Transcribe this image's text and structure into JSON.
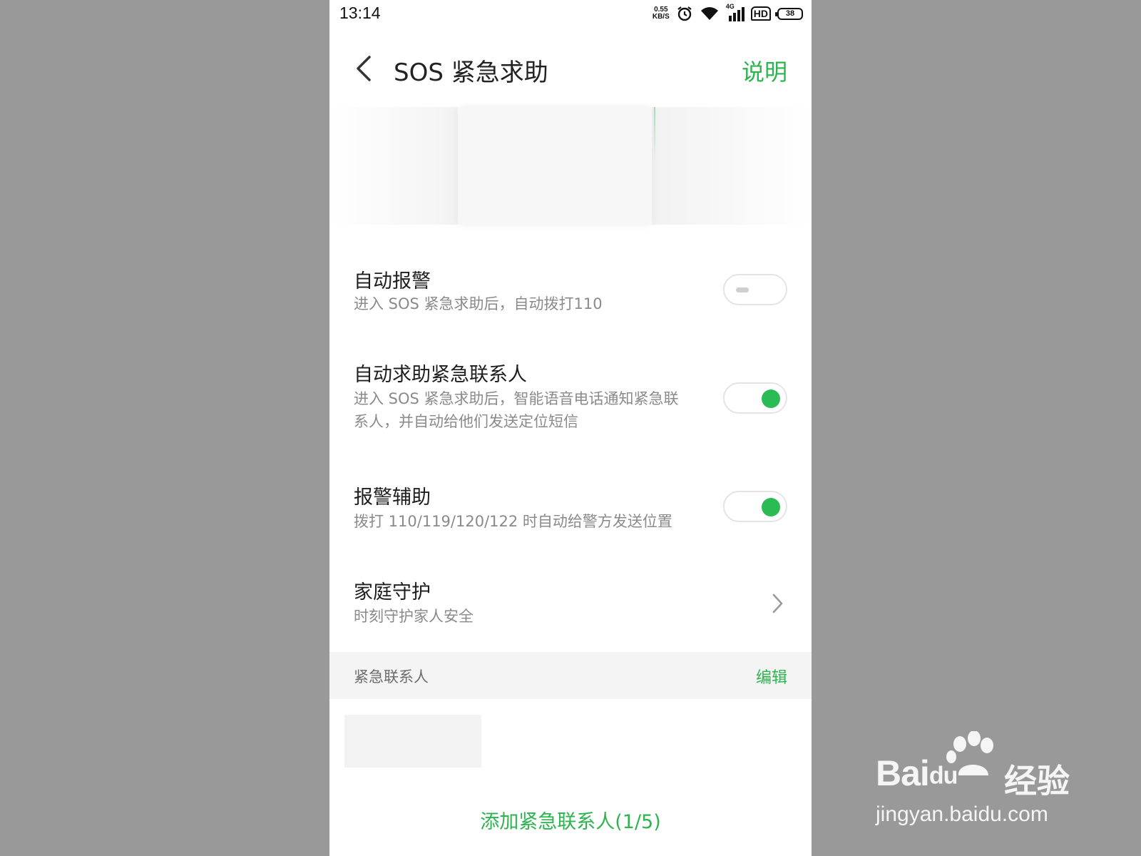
{
  "status_bar": {
    "time": "13:14",
    "net_speed_value": "0.55",
    "net_speed_unit": "KB/S",
    "network_type": "4G",
    "hd_label": "HD",
    "battery": "38",
    "icons": [
      "alarm-icon",
      "wifi-icon",
      "signal-icon",
      "hd-icon",
      "battery-icon"
    ]
  },
  "header": {
    "title": "SOS 紧急求助",
    "help_label": "说明"
  },
  "settings": [
    {
      "title": "自动报警",
      "description": "进入 SOS 紧急求助后，自动拨打110",
      "toggle_on": false
    },
    {
      "title": "自动求助紧急联系人",
      "description": "进入 SOS 紧急求助后，智能语音电话通知紧急联系人，并自动给他们发送定位短信",
      "toggle_on": true
    },
    {
      "title": "报警辅助",
      "description": "拨打 110/119/120/122 时自动给警方发送位置",
      "toggle_on": true
    },
    {
      "title": "家庭守护",
      "description": "时刻守护家人安全"
    }
  ],
  "contacts_section": {
    "title": "紧急联系人",
    "edit_label": "编辑",
    "add_label": "添加紧急联系人(1/5)"
  },
  "colors": {
    "accent": "#2db44f",
    "toggle_on": "#2bbb55",
    "backdrop": "#999999"
  },
  "watermark": {
    "brand": "Bai",
    "brand_suffix": "du",
    "chinese": "经验",
    "url": "jingyan.baidu.com"
  }
}
